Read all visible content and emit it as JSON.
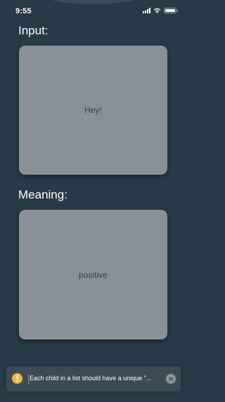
{
  "status_bar": {
    "time": "9:55",
    "icons": [
      "signal-icon",
      "wifi-icon",
      "battery-icon"
    ]
  },
  "input_section": {
    "label": "Input:",
    "value": "Hey!"
  },
  "meaning_section": {
    "label": "Meaning:",
    "value": "positive"
  },
  "warning_toast": {
    "icon": "warning-icon",
    "message": "Each child in a list should have a unique \"...",
    "close_icon": "close-icon"
  },
  "colors": {
    "background": "#263a48",
    "card": "#8a9097",
    "card_text": "#34444f",
    "toast_background": "#3c4a54",
    "warning": "#f0b84a"
  }
}
